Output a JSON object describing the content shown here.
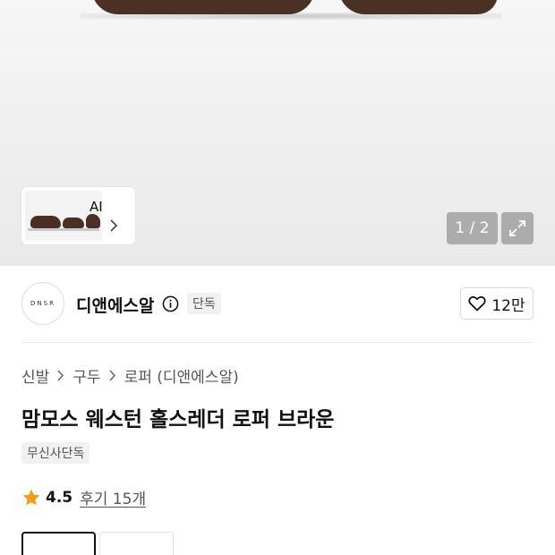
{
  "gallery": {
    "thumbnail_label": "AI",
    "counter": "1 / 2"
  },
  "brand": {
    "logo_text": "DNSR",
    "name": "디앤에스알",
    "exclusive_badge": "단독",
    "like_count": "12만"
  },
  "breadcrumb": [
    "신발",
    "구두",
    "로퍼 (디앤에스알)"
  ],
  "product": {
    "title": "맘모스 웨스턴 홀스레더 로퍼 브라운",
    "badge": "무신사단독",
    "rating": "4.5",
    "review_link": "후기 15개"
  },
  "colors": {
    "star": "#F39C12",
    "shoe_brown": "#4A3126"
  },
  "icons": [
    "chevron-right-icon",
    "expand-icon",
    "info-icon",
    "heart-icon",
    "star-icon"
  ]
}
